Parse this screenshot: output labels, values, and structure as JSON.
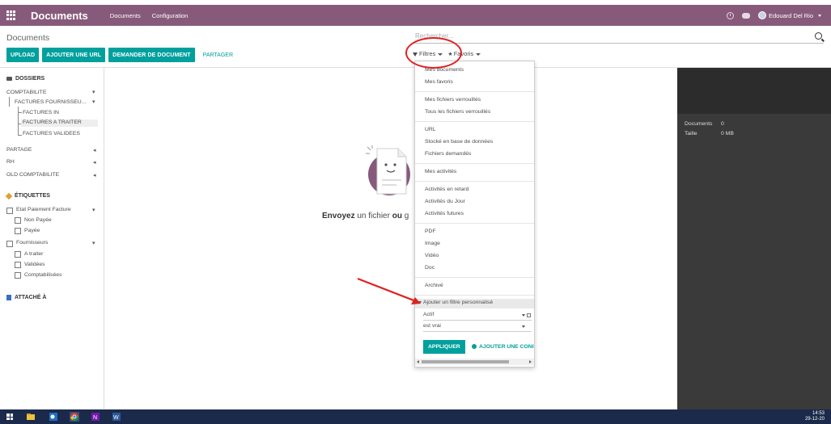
{
  "navbar": {
    "brand": "Documents",
    "links": [
      "Documents",
      "Configuration"
    ],
    "user_name": "Edouard Del Rio"
  },
  "breadcrumb": "Documents",
  "search": {
    "placeholder": "Rechercher..."
  },
  "buttons": {
    "upload": "UPLOAD",
    "add_url": "AJOUTER UNE URL",
    "request": "DEMANDER DE DOCUMENT",
    "share": "PARTAGER"
  },
  "filters": {
    "filters_label": "Filtres",
    "favorites_label": "Favoris"
  },
  "sidebar": {
    "folders_title": "DOSSIERS",
    "folders": {
      "comptabilite": "COMPTABILITE",
      "factures_fournisseurs": "FACTURES FOURNISSEU...",
      "factures_in": "FACTURES IN",
      "factures_a_traiter": "FACTURES A TRAITER",
      "factures_validees": "FACTURES VALIDEES",
      "partage": "PARTAGE",
      "rh": "RH",
      "old_comptabilite": "OLD COMPTABILITE"
    },
    "tags_title": "ÉTIQUETTES",
    "tags": {
      "etat_paiement": "Etat Paiement Facture",
      "non_payee": "Non Payée",
      "payee": "Payée",
      "fournisseurs": "Fournisseurs",
      "a_traiter": "A traiter",
      "validees": "Validées",
      "comptabilisees": "Comptabilisées"
    },
    "attached_title": "ATTACHÉ À"
  },
  "empty_state": {
    "text_bold_1": "Envoyez",
    "text_1": " un fichier ",
    "text_bold_2": "ou",
    "text_2": " g"
  },
  "right_panel": {
    "documents_label": "Documents",
    "documents_value": "0",
    "size_label": "Taille",
    "size_value": "0 MB"
  },
  "dropdown": {
    "items": {
      "mes_documents": "Mes documents",
      "mes_favoris": "Mes favoris",
      "mes_fichiers_verrouilles": "Mes fichiers verrouillés",
      "tous_fichiers_verrouilles": "Tous les fichiers verrouillés",
      "url": "URL",
      "stocke_bdd": "Stocké en base de données",
      "fichiers_demandes": "Fichiers demandés",
      "mes_activites": "Mes activités",
      "activites_retard": "Activités en retard",
      "activites_jour": "Activités du Jour",
      "activites_futures": "Activités futures",
      "pdf": "PDF",
      "image": "Image",
      "video": "Vidéo",
      "doc": "Doc",
      "archive": "Archivé"
    },
    "custom_filter_label": "Ajouter un filtre personnalisé",
    "field_value": "Actif",
    "operator_value": "est vrai",
    "apply_label": "APPLIQUER",
    "add_condition_label": "AJOUTER UNE CONI"
  },
  "taskbar": {
    "time": "14:53",
    "date": "29-12-20"
  },
  "colors": {
    "navbar": "#875a7b",
    "primary": "#00a09d",
    "annotation_red": "#e02020",
    "right_panel": "#3a3a3a",
    "taskbar": "#1b2a4b"
  }
}
